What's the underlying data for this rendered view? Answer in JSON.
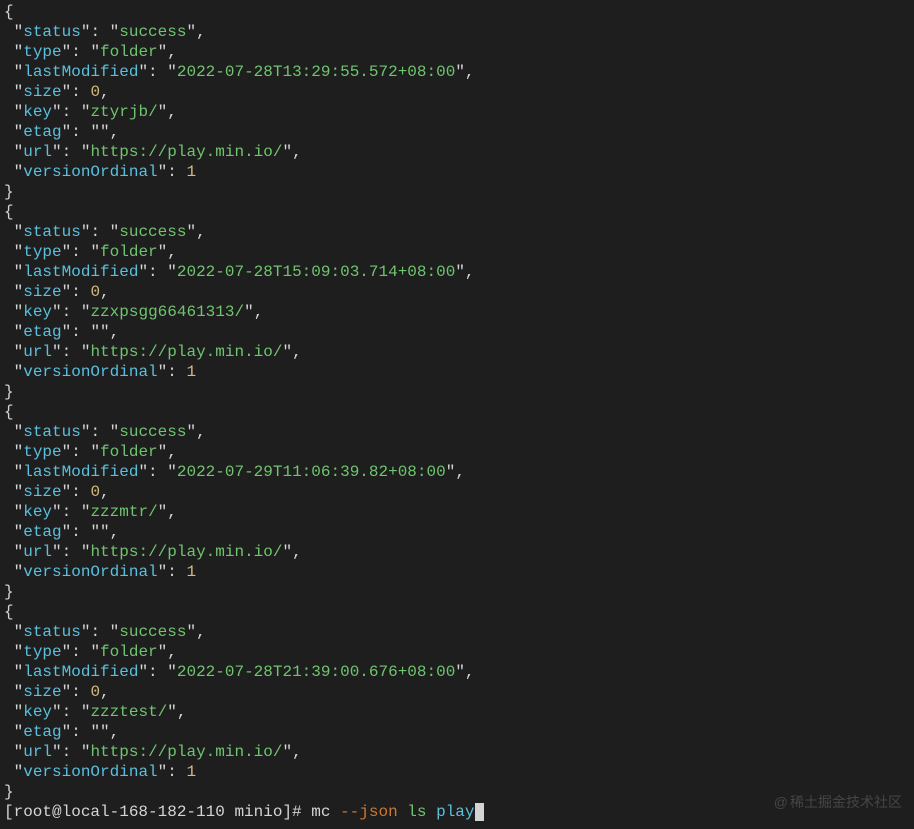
{
  "entries": [
    {
      "status": "success",
      "type": "folder",
      "lastModified": "2022-07-28T13:29:55.572+08:00",
      "size": 0,
      "key": "ztyrjb/",
      "etag": "",
      "url": "https://play.min.io/",
      "versionOrdinal": 1
    },
    {
      "status": "success",
      "type": "folder",
      "lastModified": "2022-07-28T15:09:03.714+08:00",
      "size": 0,
      "key": "zzxpsgg66461313/",
      "etag": "",
      "url": "https://play.min.io/",
      "versionOrdinal": 1
    },
    {
      "status": "success",
      "type": "folder",
      "lastModified": "2022-07-29T11:06:39.82+08:00",
      "size": 0,
      "key": "zzzmtr/",
      "etag": "",
      "url": "https://play.min.io/",
      "versionOrdinal": 1
    },
    {
      "status": "success",
      "type": "folder",
      "lastModified": "2022-07-28T21:39:00.676+08:00",
      "size": 0,
      "key": "zzztest/",
      "etag": "",
      "url": "https://play.min.io/",
      "versionOrdinal": 1
    }
  ],
  "prompt": {
    "text": "[root@local-168-182-110 minio]# ",
    "cmd_mc": "mc",
    "cmd_flag": "--json",
    "cmd_ls": "ls",
    "cmd_target": "play"
  },
  "watermark": "稀土掘金技术社区"
}
